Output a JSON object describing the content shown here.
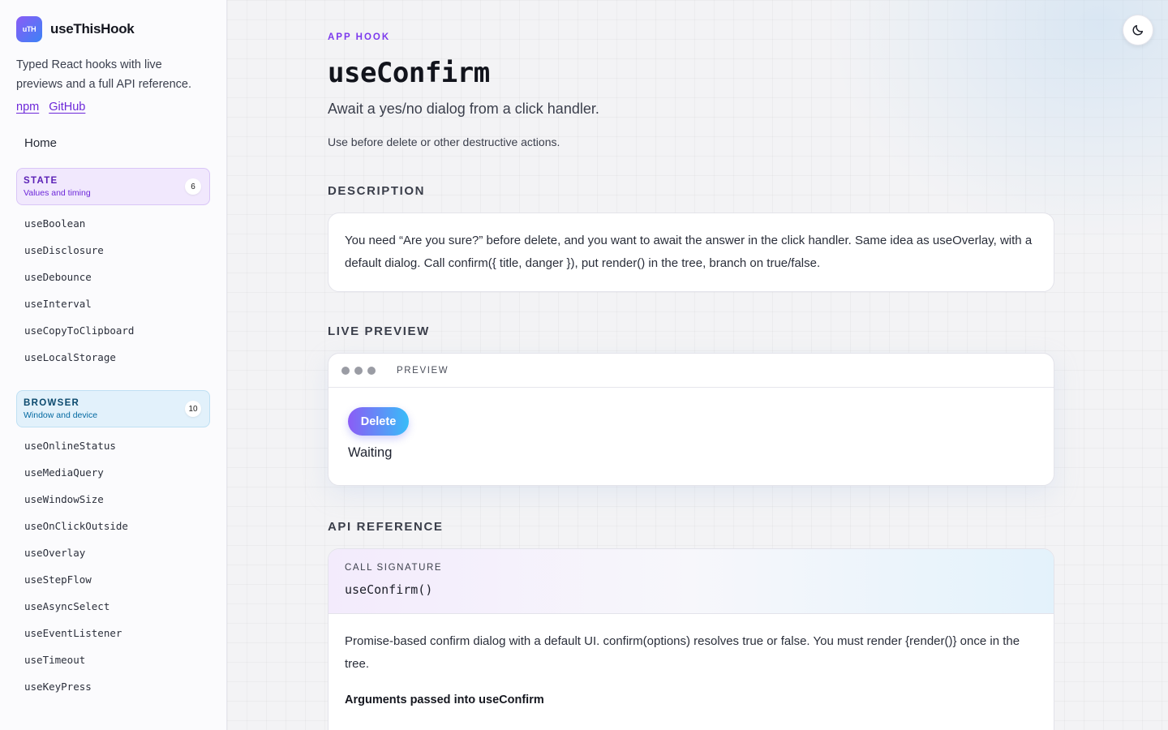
{
  "brand": {
    "logo_text": "uTH",
    "name": "useThisHook"
  },
  "sidebar": {
    "tagline": "Typed React hooks with live previews and a full API reference.",
    "links": [
      "npm",
      "GitHub"
    ],
    "home_label": "Home",
    "groups": [
      {
        "title": "STATE",
        "subtitle": "Values and timing",
        "count": "6",
        "items": [
          "useBoolean",
          "useDisclosure",
          "useDebounce",
          "useInterval",
          "useCopyToClipboard",
          "useLocalStorage"
        ]
      },
      {
        "title": "BROWSER",
        "subtitle": "Window and device",
        "count": "10",
        "items": [
          "useOnlineStatus",
          "useMediaQuery",
          "useWindowSize",
          "useOnClickOutside",
          "useOverlay",
          "useStepFlow",
          "useAsyncSelect",
          "useEventListener",
          "useTimeout",
          "useKeyPress"
        ]
      }
    ]
  },
  "header": {
    "theme_icon": "moon-icon"
  },
  "page": {
    "kicker": "APP HOOK",
    "title": "useConfirm",
    "summary": "Await a yes/no dialog from a click handler.",
    "hint": "Use before delete or other destructive actions."
  },
  "description": {
    "heading": "DESCRIPTION",
    "text": "You need “Are you sure?” before delete, and you want to await the answer in the click handler. Same idea as useOverlay, with a default dialog. Call confirm({ title, danger }), put render() in the tree, branch on true/false."
  },
  "live_preview": {
    "heading": "LIVE PREVIEW",
    "bar_label": "PREVIEW",
    "button_label": "Delete",
    "status_text": "Waiting"
  },
  "api": {
    "heading": "API REFERENCE",
    "sig_label": "CALL SIGNATURE",
    "signature": "useConfirm()",
    "body": "Promise-based confirm dialog with a default UI. confirm(options) resolves true or false. You must render {render()} once in the tree.",
    "args_heading": "Arguments passed into useConfirm"
  },
  "colors": {
    "accent": "#7c3aed",
    "state_group_bg": "#f1e8fd",
    "browser_group_bg": "#e2f1fb"
  }
}
